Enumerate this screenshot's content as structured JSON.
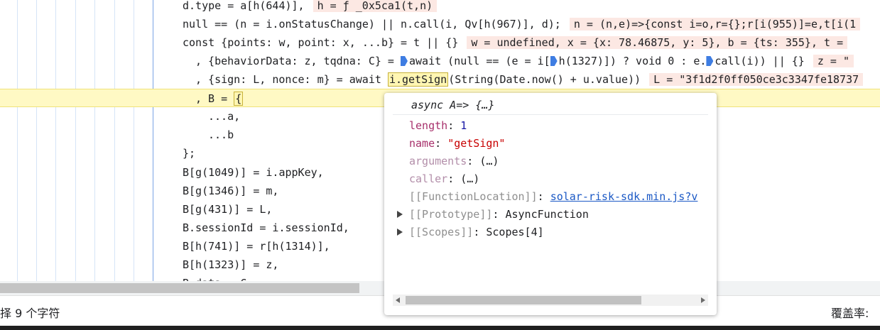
{
  "editor": {
    "lines": [
      {
        "code": "d.type = a[h(644)],",
        "inline": "h = ƒ _0x5ca1(t,n)"
      },
      {
        "code": "null == (n = i.onStatusChange) || n.call(i, Qv[h(967)], d);",
        "inline": "n = (n,e)=>{const i=o,r={};r[i(955)]=e,t[i(1"
      },
      {
        "code": "const {points: w, point: x, ...b} = t || {}",
        "inline": "w = undefined, x = {x: 78.46875, y: 5}, b = {ts: 355}, t ="
      },
      {
        "code_parts": [
          ", {behaviorData: z, tqdna: C} = ",
          "await (null == (e = i[",
          "h(1327)]) ? void 0 : e.",
          "call(i)) || {}"
        ],
        "inline": "z = \""
      },
      {
        "code_parts": [
          ", {sign: L, nonce: m} = await ",
          "i.getSign",
          "(String(Date.now() + u.value))"
        ],
        "inline": "L = \"3f1d2f0ff050ce3c3347fe18737"
      },
      {
        "code_parts": [
          ", B = ",
          "{"
        ]
      },
      {
        "code": "...a,"
      },
      {
        "code": "...b"
      },
      {
        "code": "};"
      },
      {
        "code": "B[g(1049)] = i.appKey,"
      },
      {
        "code": "B[g(1346)] = m,"
      },
      {
        "code": "B[g(431)] = L,"
      },
      {
        "code": "B.sessionId = i.sessionId,"
      },
      {
        "code": "B[h(741)] = r[h(1314)],"
      },
      {
        "code": "B[h(1323)] = z,"
      },
      {
        "code": "B.data = C,"
      }
    ]
  },
  "popover": {
    "title": "async A=> {…}",
    "props": [
      {
        "name": "length",
        "sep": ": ",
        "value": "1",
        "kind": "num"
      },
      {
        "name": "name",
        "sep": ": ",
        "value": "\"getSign\"",
        "kind": "str"
      },
      {
        "name": "arguments",
        "sep": ": ",
        "value": "(…)",
        "kind": "ellip"
      },
      {
        "name": "caller",
        "sep": ": ",
        "value": "(…)",
        "kind": "ellip"
      },
      {
        "name": "[[FunctionLocation]]",
        "sep": ": ",
        "value": "solar-risk-sdk.min.js?v",
        "kind": "link"
      },
      {
        "name": "[[Prototype]]",
        "sep": ": ",
        "value": "AsyncFunction",
        "kind": "plain"
      },
      {
        "name": "[[Scopes]]",
        "sep": ": ",
        "value": "Scopes[4]",
        "kind": "plain"
      }
    ]
  },
  "status": {
    "left": "择 9 个字符",
    "right": "覆盖率:"
  }
}
